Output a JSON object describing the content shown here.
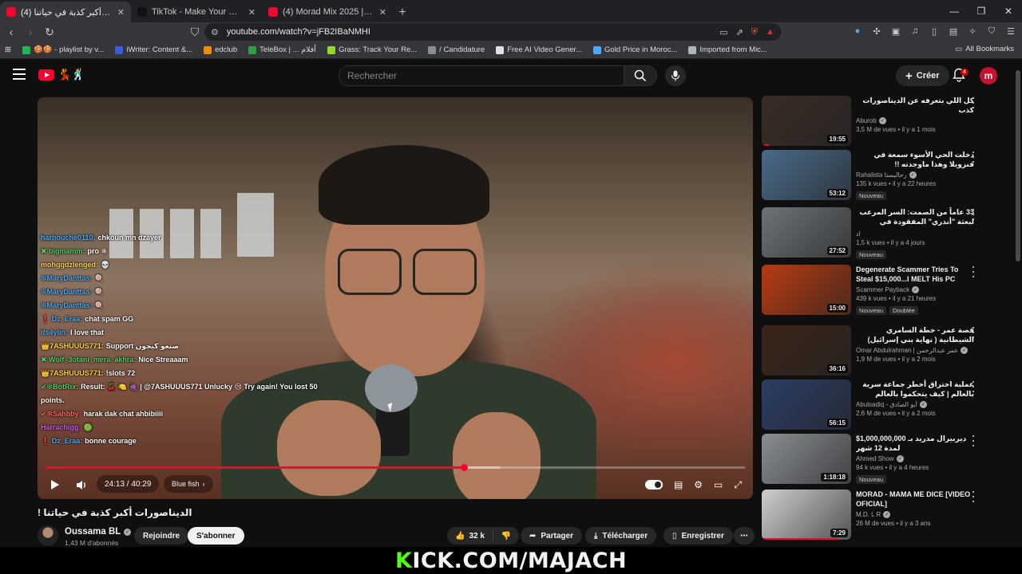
{
  "browser": {
    "tabs": [
      {
        "title": "(4) الديناصورات أكبر كذبة في حياتنا",
        "favicon_color": "#ff0033",
        "active": true
      },
      {
        "title": "TikTok - Make Your Day",
        "favicon_color": "#111111",
        "active": false
      },
      {
        "title": "(4) Morad Mix 2025 | Lo Mejor de",
        "favicon_color": "#ff0033",
        "active": false
      }
    ],
    "url": "youtube.com/watch?v=jFB2IBaNMHI",
    "bookmarks": [
      {
        "label": "🍪🍪 - playlist by v...",
        "color": "#1db954"
      },
      {
        "label": "iWriter: Content &...",
        "color": "#3b5bdb"
      },
      {
        "label": "edclub",
        "color": "#f08c00"
      },
      {
        "label": "TeleBox | ... أفلام",
        "color": "#2f9e44"
      },
      {
        "label": "Grass: Track Your Re...",
        "color": "#94d82d"
      },
      {
        "label": "/ Candidature",
        "color": "#868e96"
      },
      {
        "label": "Free AI Video Gener...",
        "color": "#dee2e6"
      },
      {
        "label": "Gold Price in Moroc...",
        "color": "#4dabf7"
      },
      {
        "label": "Imported from Mic...",
        "color": "#adb5bd"
      }
    ],
    "all_bookmarks": "All Bookmarks"
  },
  "youtube": {
    "search_placeholder": "Rechercher",
    "create_label": "Créer",
    "notif_count": "4",
    "avatar_letter": "m"
  },
  "player": {
    "time": "24:13 / 40:29",
    "chapter": "Blue fish",
    "played_fraction": 0.598,
    "buffered_fraction": 0.65
  },
  "chat": [
    {
      "user": "harbouche0110:",
      "color": "#4dabf7",
      "msg": "chkoun mn dzayer"
    },
    {
      "user": "✖ bigmamm:",
      "color": "#51cf66",
      "msg": "pro ❄"
    },
    {
      "user": "mohggdzlenged:",
      "color": "#ffd43b",
      "msg": "💀"
    },
    {
      "user": "❇MaryDanttas:",
      "color": "#4dabf7",
      "msg": "🍭"
    },
    {
      "user": "❇MaryDanttas:",
      "color": "#4dabf7",
      "msg": "🍭"
    },
    {
      "user": "❇MaryDanttas:",
      "color": "#4dabf7",
      "msg": "🍭"
    },
    {
      "user": "❗ Dz_Eraa:",
      "color": "#4dabf7",
      "msg": "chat spam GG"
    },
    {
      "user": "its4ylin:",
      "color": "#4dabf7",
      "msg": "I love that"
    },
    {
      "user": "👑7ASHUUUS771:",
      "color": "#ffd43b",
      "msg": "Support صنعو كيحون"
    },
    {
      "user": "✖ Wolf_3otani_mera_akhra:",
      "color": "#51cf66",
      "msg": "Nice Streaaam"
    },
    {
      "user": "👑7ASHUUUS771:",
      "color": "#ffd43b",
      "msg": "!slots 72"
    },
    {
      "user": "✔❇BotRix:",
      "color": "#51cf66",
      "msg": "Result: 🍒 🍋 🍇 | @7ASHUUUS771 Unlucky 😢 Try again! You lost 50 points."
    },
    {
      "user": "✔❇Sahbby:",
      "color": "#ff6b6b",
      "msg": "harak dak chat ahbibiiii"
    },
    {
      "user": "Harrachigg:",
      "color": "#cc5de8",
      "msg": "🟢"
    },
    {
      "user": "❗ Dz_Eraa:",
      "color": "#4dabf7",
      "msg": "bonne courage"
    }
  ],
  "video": {
    "title": "الديناصورات أكبر كذبة في حياتنا !",
    "channel": "Oussama BL",
    "subscribers": "1,43 M d'abonnés",
    "join_label": "Rejoindre",
    "subscribe_label": "S'abonner",
    "likes": "32 k",
    "share_label": "Partager",
    "download_label": "Télécharger",
    "save_label": "Enregistrer"
  },
  "recommendations": [
    {
      "title": "كل اللي بتعرفه عن الديناصورات كذب",
      "rtl": true,
      "channel": "Aburob",
      "verified": true,
      "meta": "3,5 M de vues • il y a 1 mois",
      "duration": "19:55",
      "badges": [],
      "thumb": "#3a2c26",
      "progress": 0.08
    },
    {
      "title": "دخلت الحي الأسوء سمعة في فنزويلا وهذا ماوجدته !!",
      "rtl": true,
      "channel": "Rahalista رحاليستا",
      "verified": true,
      "meta": "135 k vues • il y a 22 heures",
      "duration": "53:12",
      "badges": [
        "Nouveau"
      ],
      "thumb": "#4a6a88",
      "progress": 0
    },
    {
      "title": "33 عاماً من الصمت: السر المرعب لبعثة \"أندري\" المفقودة في القطب الشمالي | وثائقي",
      "rtl": true,
      "channel": "اد",
      "verified": false,
      "meta": "1,5 k vues • il y a 4 jours",
      "duration": "27:52",
      "badges": [
        "Nouveau"
      ],
      "thumb": "#6d7378",
      "progress": 0
    },
    {
      "title": "Degenerate Scammer Tries To Steal $15,000...I MELT His PC",
      "rtl": false,
      "channel": "Scammer Payback",
      "verified": true,
      "meta": "439 k vues • il y a 21 heures",
      "duration": "15:00",
      "badges": [
        "Nouveau",
        "Doublée"
      ],
      "thumb": "#b83a12",
      "progress": 0
    },
    {
      "title": "قصة عمر - خطة السامري الشيطانية ( نهاية بني إسرائيل)",
      "rtl": true,
      "channel": "Omar Abdulrahman | عمر عبدالرحمن",
      "verified": true,
      "meta": "1,9 M de vues • il y a 2 mois",
      "duration": "36:16",
      "badges": [],
      "thumb": "#3a2418",
      "progress": 0
    },
    {
      "title": "عملية اختراق أخطر جماعة سرية بالعالم | كيف يتحكموا بالعالم",
      "rtl": true,
      "channel": "Abulsadiq - أبو الصادق",
      "verified": true,
      "meta": "2,6 M de vues • il y a 2 mois",
      "duration": "56:15",
      "badges": [],
      "thumb": "#2c3e66",
      "progress": 0
    },
    {
      "title": "$1,000,000,000 ديربيرال مدريد بـ لمدة 12 شهر",
      "rtl": false,
      "channel": "Ahmed Show",
      "verified": true,
      "meta": "94 k vues • il y a 4 heures",
      "duration": "1:18:18",
      "badges": [
        "Nouveau"
      ],
      "thumb": "#8a8e94",
      "progress": 0
    },
    {
      "title": "MORAD - MAMA ME DICE [VIDEO OFICIAL]",
      "rtl": false,
      "channel": "M.D. L R",
      "verified": true,
      "meta": "26 M de vues • il y a 3 ans",
      "duration": "7:29",
      "badges": [],
      "thumb": "#cfcfcf",
      "progress": 0.85
    }
  ],
  "overlay": {
    "k": "K",
    "rest": "ICK.COM/MAJACH"
  }
}
